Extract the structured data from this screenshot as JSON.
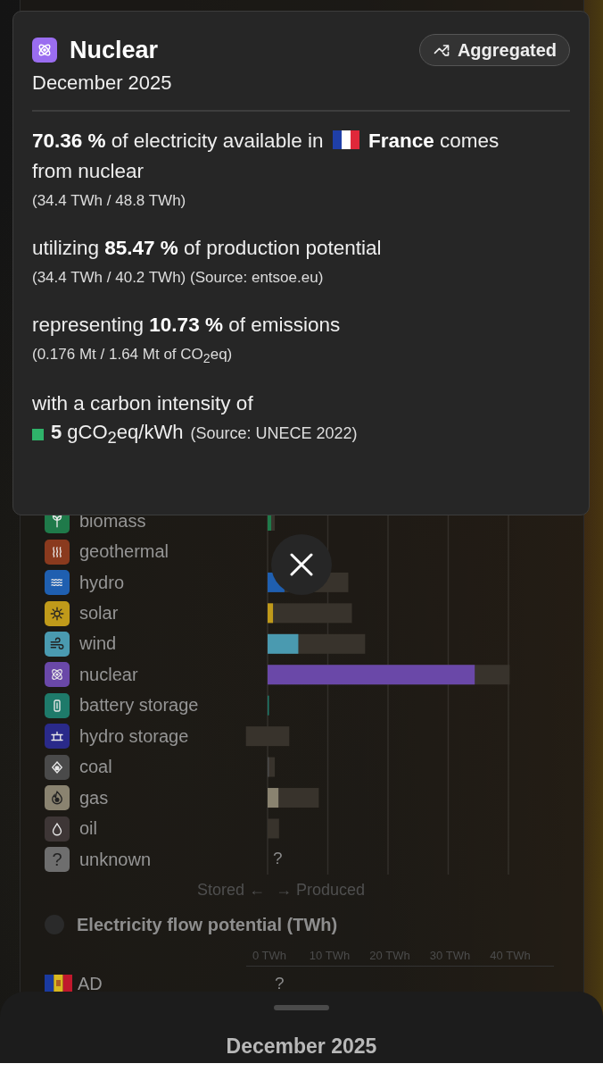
{
  "tooltip": {
    "title": "Nuclear",
    "subtitle": "December 2025",
    "badge": {
      "label": "Aggregated"
    },
    "share": {
      "before": "**70.36 %** of electricity available in",
      "after": "**France** comes",
      "after_line2": "from nuclear",
      "detail": "(34.4 TWh / 48.8 TWh)"
    },
    "utilization": {
      "text": "utilizing **85.47 %** of production potential",
      "detail": "(34.4 TWh / 40.2 TWh) (Source: entsoe.eu)"
    },
    "emissions": {
      "text": "representing **10.73 %** of emissions",
      "detail": "(0.176 Mt / 1.64 Mt of CO$_{2}$eq)"
    },
    "intensity": {
      "text": "with a carbon intensity of",
      "value": "**5** gCO$_{2}$eq/kWh",
      "source": "(Source: UNECE 2022)",
      "color": "#2fb36a"
    }
  },
  "production": {
    "sources": [
      {
        "kind": "biomass",
        "label": "biomass",
        "color": "#1f7a4a"
      },
      {
        "kind": "geothermal",
        "label": "geothermal",
        "color": "#8a3a1e"
      },
      {
        "kind": "hydro",
        "label": "hydro",
        "color": "#1f5fb0"
      },
      {
        "kind": "solar",
        "label": "solar",
        "color": "#c09a1a"
      },
      {
        "kind": "wind",
        "label": "wind",
        "color": "#4a9ab0"
      },
      {
        "kind": "nuclear",
        "label": "nuclear",
        "color": "#6a48a8"
      },
      {
        "kind": "battery",
        "label": "battery storage",
        "color": "#1e7a6a"
      },
      {
        "kind": "pumped",
        "label": "hydro storage",
        "color": "#2a2a8a"
      },
      {
        "kind": "coal",
        "label": "coal",
        "color": "#4a4a4a"
      },
      {
        "kind": "gas",
        "label": "gas",
        "color": "#8a8370"
      },
      {
        "kind": "oil",
        "label": "oil",
        "color": "#3e3636"
      },
      {
        "kind": "unknown",
        "label": "unknown",
        "color": "#6e6e6e",
        "icon_label": "?",
        "note": "?"
      }
    ],
    "stored_label": "Stored ←",
    "produced_label": "→ Produced"
  },
  "flow": {
    "selected": false,
    "title": "Electricity flow potential (TWh)",
    "ticks": [
      "0 TWh",
      "10 TWh",
      "20 TWh",
      "30 TWh",
      "40 TWh"
    ],
    "rows": [
      {
        "label": "AD",
        "note": "?"
      }
    ]
  },
  "sheet": {
    "title": "December 2025"
  }
}
